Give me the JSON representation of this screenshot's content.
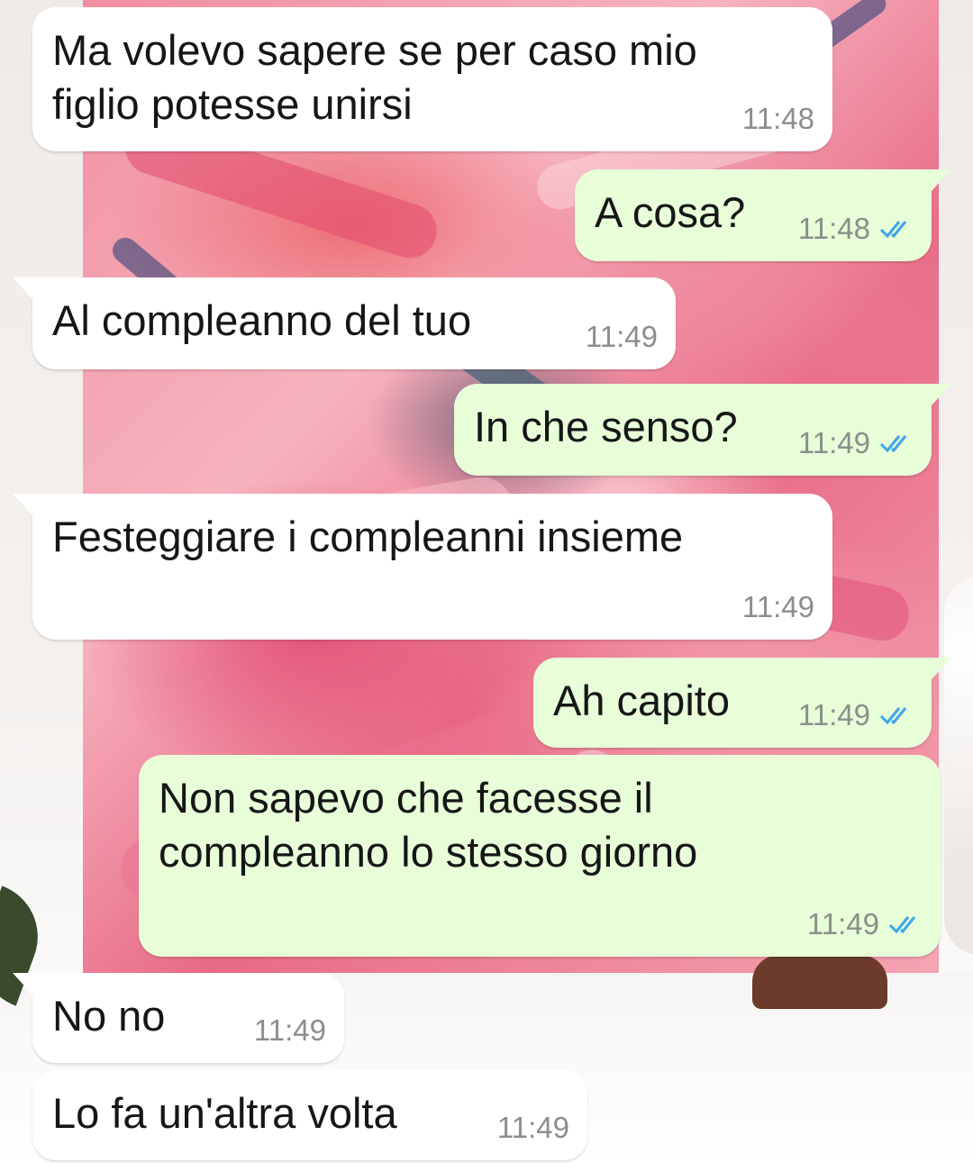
{
  "colors": {
    "incoming_bubble": "#ffffff",
    "outgoing_bubble": "#e7fed9",
    "text": "#161616",
    "timestamp": "#8a8f8a",
    "read_ticks": "#3ea5e8"
  },
  "messages": [
    {
      "direction": "incoming",
      "text": "Ma volevo sapere se per caso mio\nfiglio potesse unirsi",
      "time": "11:48"
    },
    {
      "direction": "outgoing",
      "text": "A cosa?",
      "time": "11:48",
      "status_icon": "double-check-read-icon"
    },
    {
      "direction": "incoming",
      "text": "Al compleanno del tuo",
      "time": "11:49"
    },
    {
      "direction": "outgoing",
      "text": "In che senso?",
      "time": "11:49",
      "status_icon": "double-check-read-icon"
    },
    {
      "direction": "incoming",
      "text": "Festeggiare i compleanni insieme",
      "time": "11:49"
    },
    {
      "direction": "outgoing",
      "text": "Ah capito",
      "time": "11:49",
      "status_icon": "double-check-read-icon"
    },
    {
      "direction": "outgoing",
      "text": "Non sapevo che facesse il\ncompleanno lo stesso giorno",
      "time": "11:49",
      "status_icon": "double-check-read-icon"
    },
    {
      "direction": "incoming",
      "text": "No no",
      "time": "11:49"
    },
    {
      "direction": "incoming",
      "text": "Lo fa un'altra volta",
      "time": "11:49"
    }
  ]
}
